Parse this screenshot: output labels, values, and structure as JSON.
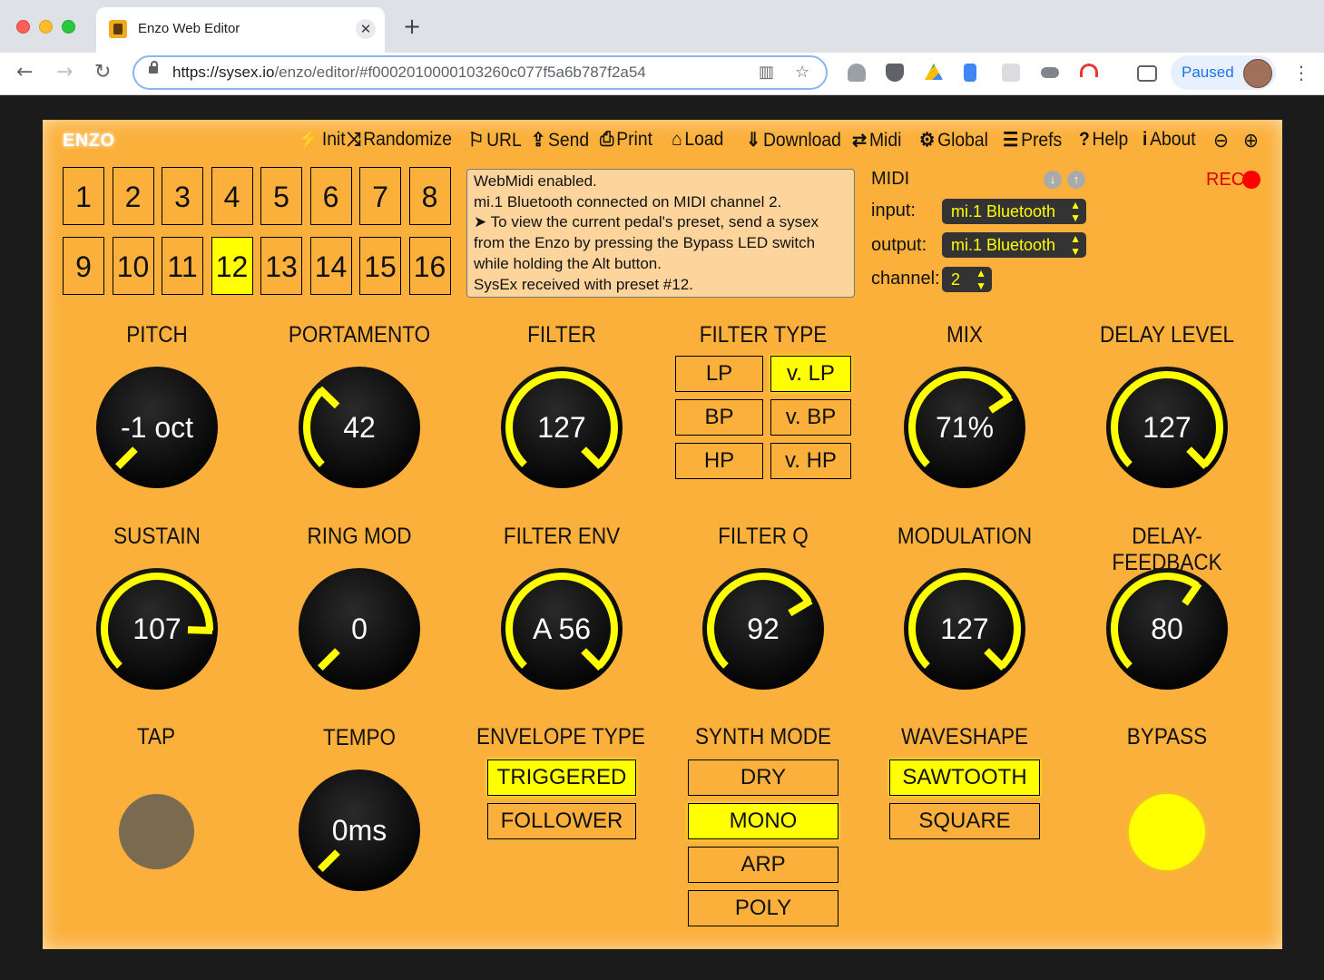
{
  "browser": {
    "tab_title": "Enzo Web Editor",
    "tab_close": "✕",
    "new_tab": "+",
    "url_domain": "https://sysex.io",
    "url_path": "/enzo/editor/",
    "url_hash": "#f0002010000103260c077f5a6b787f2a54",
    "profile_status": "Paused"
  },
  "app": {
    "logo": "ENZO",
    "menu": [
      {
        "icon": "⚡",
        "label": "Init"
      },
      {
        "icon": "⤨",
        "label": "Randomize"
      },
      {
        "icon": "⚐",
        "label": "URL"
      },
      {
        "icon": "⇪",
        "label": "Send"
      },
      {
        "icon": "⎙",
        "label": "Print"
      },
      {
        "icon": "⌂",
        "label": "Load"
      },
      {
        "icon": "⇓",
        "label": "Download"
      },
      {
        "icon": "⇄",
        "label": "Midi"
      },
      {
        "icon": "⚙",
        "label": "Global"
      },
      {
        "icon": "☰",
        "label": "Prefs"
      },
      {
        "icon": "?",
        "label": "Help"
      },
      {
        "icon": "i",
        "label": "About"
      }
    ],
    "presets": [
      "1",
      "2",
      "3",
      "4",
      "5",
      "6",
      "7",
      "8",
      "9",
      "10",
      "11",
      "12",
      "13",
      "14",
      "15",
      "16"
    ],
    "selected_preset": "12",
    "messages": [
      "WebMidi enabled.",
      "mi.1 Bluetooth connected on MIDI channel 2.",
      "➤ To view the current pedal's preset, send a sysex",
      "from the Enzo by pressing the Bypass LED switch",
      "while holding the Alt button.",
      "SysEx received with preset #12."
    ],
    "midi": {
      "title": "MIDI",
      "input_label": "input:",
      "input_value": "mi.1 Bluetooth",
      "output_label": "output:",
      "output_value": "mi.1 Bluetooth",
      "channel_label": "channel:",
      "channel_value": "2",
      "rec_label": "REC"
    },
    "accent_color": "#ffff00",
    "panel_color": "#fbb03b",
    "knobs": [
      {
        "id": "pitch",
        "label": "PITCH",
        "value": "-1 oct",
        "level": 0.0
      },
      {
        "id": "portamento",
        "label": "PORTAMENTO",
        "value": "42",
        "level": 0.33
      },
      {
        "id": "filter",
        "label": "FILTER",
        "value": "127",
        "level": 1.0
      },
      {
        "id": "mix",
        "label": "MIX",
        "value": "71%",
        "level": 0.71
      },
      {
        "id": "delay-level",
        "label": "DELAY LEVEL",
        "value": "127",
        "level": 1.0
      },
      {
        "id": "sustain",
        "label": "SUSTAIN",
        "value": "107",
        "level": 0.84
      },
      {
        "id": "ring-mod",
        "label": "RING MOD",
        "value": "0",
        "level": 0.0
      },
      {
        "id": "filter-env",
        "label": "FILTER ENV",
        "value": "A 56",
        "level": 1.0
      },
      {
        "id": "filter-q",
        "label": "FILTER Q",
        "value": "92",
        "level": 0.72
      },
      {
        "id": "modulation",
        "label": "MODULATION",
        "value": "127",
        "level": 1.0
      },
      {
        "id": "delay-feedback",
        "label": "DELAY-FEEDBACK",
        "value": "80",
        "level": 0.63
      },
      {
        "id": "tempo",
        "label": "TEMPO",
        "value": "0ms",
        "level": 0.0
      }
    ],
    "filter_type": {
      "label": "FILTER TYPE",
      "options": [
        "LP",
        "v. LP",
        "BP",
        "v. BP",
        "HP",
        "v. HP"
      ],
      "selected": "v. LP"
    },
    "envelope_type": {
      "label": "ENVELOPE TYPE",
      "options": [
        "TRIGGERED",
        "FOLLOWER"
      ],
      "selected": "TRIGGERED"
    },
    "synth_mode": {
      "label": "SYNTH MODE",
      "options": [
        "DRY",
        "MONO",
        "ARP",
        "POLY"
      ],
      "selected": "MONO"
    },
    "waveshape": {
      "label": "WAVESHAPE",
      "options": [
        "SAWTOOTH",
        "SQUARE"
      ],
      "selected": "SAWTOOTH"
    },
    "tap_label": "TAP",
    "bypass_label": "BYPASS"
  }
}
